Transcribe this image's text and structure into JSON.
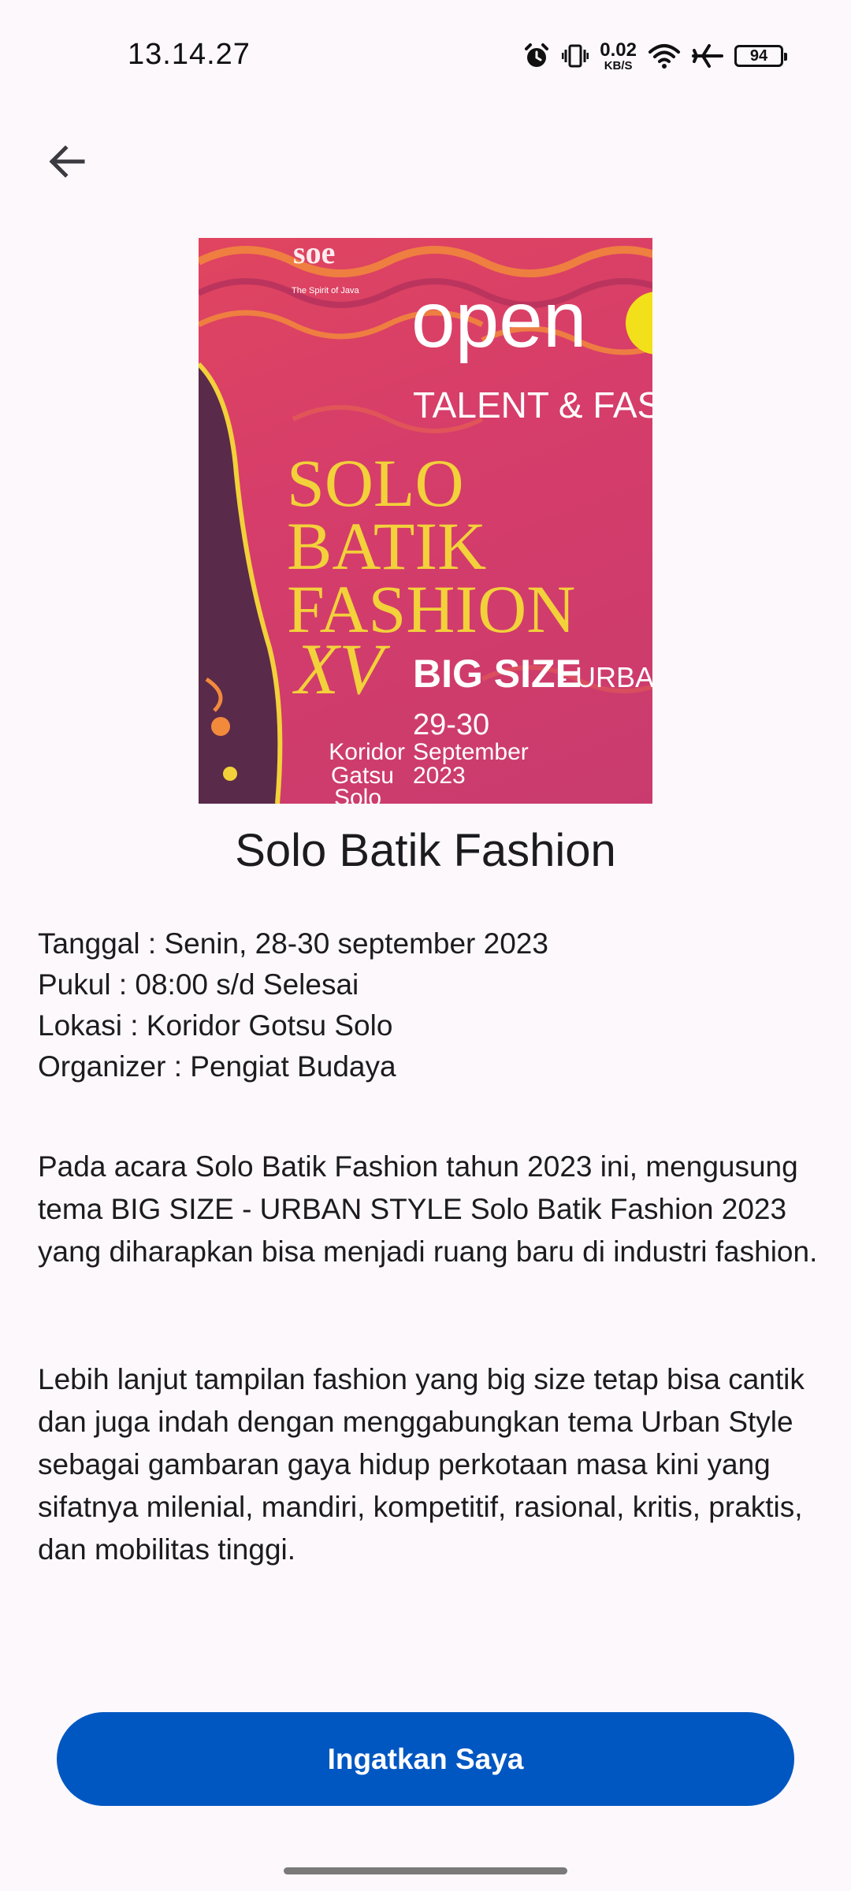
{
  "status_bar": {
    "time": "13.14.27",
    "net_speed_value": "0.02",
    "net_speed_unit": "KB/S",
    "battery": "94"
  },
  "header": {
    "back_icon": "arrow-left-icon"
  },
  "poster": {
    "logo_tagline": "The Spirit of Java",
    "brand": "open",
    "subtitle": "TALENT & FASHI",
    "title_line1": "SOLO",
    "title_line2": "BATIK",
    "title_line3": "FASHION",
    "edition": "XV",
    "theme": "BIG SIZE",
    "theme_suffix": "- URBAN",
    "date_days": "29-30",
    "date_month": "September",
    "date_year": "2023",
    "venue_line1": "Koridor",
    "venue_line2": "Gatsu",
    "venue_line3": "Solo"
  },
  "event": {
    "title": "Solo Batik Fashion",
    "date": "Tanggal : Senin, 28-30 september 2023",
    "time": "Pukul : 08:00 s/d Selesai",
    "location": "Lokasi : Koridor Gotsu Solo",
    "organizer": "Organizer : Pengiat Budaya",
    "description_1": "Pada acara Solo Batik Fashion tahun 2023 ini, mengusung tema BIG SIZE - URBAN STYLE Solo Batik Fashion 2023 yang diharapkan bisa menjadi ruang baru di industri fashion.",
    "description_2": "Lebih lanjut tampilan fashion yang big size tetap bisa cantik dan juga indah dengan menggabungkan tema Urban Style sebagai gambaran gaya hidup perkotaan masa kini yang sifatnya milenial, mandiri, kompetitif, rasional, kritis, praktis, dan mobilitas tinggi."
  },
  "actions": {
    "remind_label": "Ingatkan Saya"
  },
  "colors": {
    "background": "#fcf8fc",
    "primary_button": "#0157c2",
    "poster_pink": "#d63d6a",
    "poster_gold": "#f2d13a"
  }
}
